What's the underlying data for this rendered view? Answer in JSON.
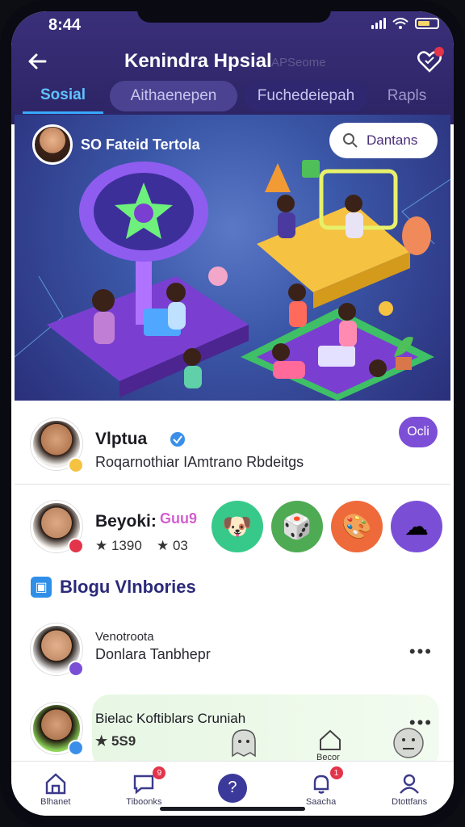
{
  "status": {
    "time": "8:44"
  },
  "header": {
    "title": "Kenindra Hpsial",
    "subtitle": "APSeome"
  },
  "tabs": [
    {
      "label": "Sosial"
    },
    {
      "label": "Aithaenepen"
    },
    {
      "label": "Fuchedeiepah"
    },
    {
      "label": "Rapls"
    }
  ],
  "hero": {
    "user_name": "SO Fateid Tertola",
    "search_label": "Dantans"
  },
  "post1": {
    "name": "Vlptua",
    "desc": "Roqarnothiar IAmtrano Rbdeitgs",
    "action": "Ocli"
  },
  "post2": {
    "name": "Beyoki:",
    "tag": "Guu9",
    "stat1": "★ 1390",
    "stat2": "★ 03"
  },
  "section": {
    "icon": "photo-icon",
    "title": "Blogu Vlnbories"
  },
  "post3": {
    "name": "Venotroota",
    "desc": "Donlara Tanbhepr",
    "more": "•••"
  },
  "post4": {
    "name": "Bielac Koftiblars Cruniah",
    "stat": "★ 5S9",
    "more": "•••",
    "icon_label": "Becor"
  },
  "bottom_nav": [
    {
      "label": "Blhanet",
      "icon": "home-icon"
    },
    {
      "label": "Tiboonks",
      "icon": "chat-icon",
      "badge": "9"
    },
    {
      "label": "",
      "icon": "help-icon"
    },
    {
      "label": "Saacha",
      "icon": "bell-icon",
      "badge": "1"
    },
    {
      "label": "Dtottfans",
      "icon": "profile-icon"
    }
  ],
  "colors": {
    "header_bg": "#2c2464",
    "accent_blue": "#38a9ff",
    "purple_button": "#7d4fd6",
    "badge_red": "#e4344a"
  }
}
